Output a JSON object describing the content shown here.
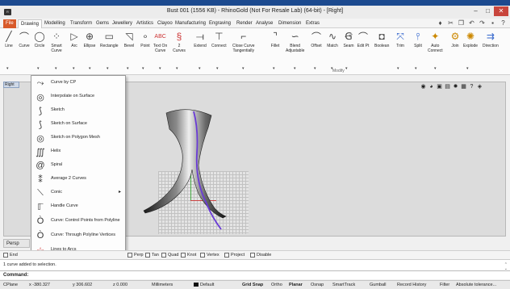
{
  "window": {
    "title": "Bust 001 (1556 KB) - RhinoGold (Not For Resale Lab) (64-bit) - [Right]",
    "app_icon": "rhino-icon",
    "controls": [
      "–",
      "□",
      "✕"
    ]
  },
  "tabs": [
    "File",
    "Drawing",
    "Modelling",
    "Transform",
    "Gems",
    "Jewellery",
    "Artistics",
    "Clayoo",
    "Manufacturing",
    "Engraving",
    "Render",
    "Analyse",
    "Dimension",
    "Extras"
  ],
  "active_tab": "Drawing",
  "ribbon_tools": [
    {
      "label": "Line",
      "icon": "line-icon"
    },
    {
      "label": "Curve",
      "icon": "curve-icon"
    },
    {
      "label": "Circle",
      "icon": "circle-icon"
    },
    {
      "label": "Smart\nCurve",
      "icon": "smart-curve-icon"
    },
    {
      "label": "Arc",
      "icon": "arc-icon"
    },
    {
      "label": "Ellipse",
      "icon": "ellipse-icon"
    },
    {
      "label": "Rectangle",
      "icon": "rectangle-icon"
    },
    {
      "label": "Bevel",
      "icon": "bevel-icon"
    },
    {
      "label": "Point",
      "icon": "point-icon"
    },
    {
      "label": "Text On\nCurve",
      "icon": "text-on-curve-icon"
    },
    {
      "label": "2\nCurves",
      "icon": "two-curves-icon"
    },
    {
      "label": "Extend",
      "icon": "extend-icon"
    },
    {
      "label": "Connect",
      "icon": "connect-icon"
    },
    {
      "label": "Close Curve\nTangentially",
      "icon": "close-curve-icon"
    },
    {
      "label": "Fillet",
      "icon": "fillet-icon"
    },
    {
      "label": "Blend\nAdjustable",
      "icon": "blend-icon"
    },
    {
      "label": "Offset",
      "icon": "offset-icon"
    },
    {
      "label": "Match",
      "icon": "match-icon"
    },
    {
      "label": "Seam",
      "icon": "seam-icon"
    },
    {
      "label": "Edit Pt",
      "icon": "edit-points-icon"
    },
    {
      "label": "Boolean",
      "icon": "boolean-icon"
    },
    {
      "label": "Trim",
      "icon": "trim-icon"
    },
    {
      "label": "Split",
      "icon": "split-icon"
    },
    {
      "label": "Auto\nConnect",
      "icon": "auto-connect-icon"
    },
    {
      "label": "Join",
      "icon": "join-icon"
    },
    {
      "label": "Explode",
      "icon": "explode-icon"
    },
    {
      "label": "Direction",
      "icon": "direction-icon"
    }
  ],
  "ribbon_group_label": "Modify",
  "viewport_label": "Right",
  "curve_menu": [
    {
      "label": "Curve by CP",
      "icon": "curve-by-cp-icon"
    },
    {
      "label": "Interpolate on Surface",
      "icon": "interpolate-surface-icon"
    },
    {
      "label": "Sketch",
      "icon": "sketch-icon"
    },
    {
      "label": "Sketch on Surface",
      "icon": "sketch-surface-icon"
    },
    {
      "label": "Sketch on Polygon Mesh",
      "icon": "sketch-mesh-icon"
    },
    {
      "label": "Helix",
      "icon": "helix-icon"
    },
    {
      "label": "Spiral",
      "icon": "spiral-icon"
    },
    {
      "label": "Average 2 Curves",
      "icon": "average-curves-icon"
    },
    {
      "label": "Conic",
      "icon": "conic-icon",
      "submenu": true
    },
    {
      "label": "Handle Curve",
      "icon": "handle-curve-icon"
    },
    {
      "label": "Curve: Control Points from Polyline",
      "icon": "cp-from-polyline-icon"
    },
    {
      "label": "Curve: Through Polyline Vertices",
      "icon": "through-vertices-icon"
    },
    {
      "label": "Lines to Arcs",
      "icon": "lines-to-arcs-icon"
    }
  ],
  "bottom_tab": "Persp",
  "osnaps": [
    {
      "label": "End",
      "checked": false
    },
    {
      "label": "Perp",
      "checked": false
    },
    {
      "label": "Tan",
      "checked": false
    },
    {
      "label": "Quad",
      "checked": false
    },
    {
      "label": "Knot",
      "checked": false
    },
    {
      "label": "Vertex",
      "checked": false
    },
    {
      "label": "Project",
      "checked": false
    },
    {
      "label": "Disable",
      "checked": false
    }
  ],
  "history_text": "1 curve added to selection.",
  "command_label": "Command:",
  "status": {
    "cplane": "CPlane",
    "x": "x -380.327",
    "y": "y 306.602",
    "z": "z 0.000",
    "units": "Millimeters",
    "layer": "Default",
    "toggles": [
      "Grid Snap",
      "Ortho",
      "Planar",
      "Osnap",
      "SmartTrack",
      "Gumball",
      "Record History",
      "Filter",
      "Absolute tolerance..."
    ]
  },
  "colors": {
    "file_tab": "#d85a2a",
    "title_accent": "#1c4a8f",
    "curve": "#6a3bd6"
  }
}
